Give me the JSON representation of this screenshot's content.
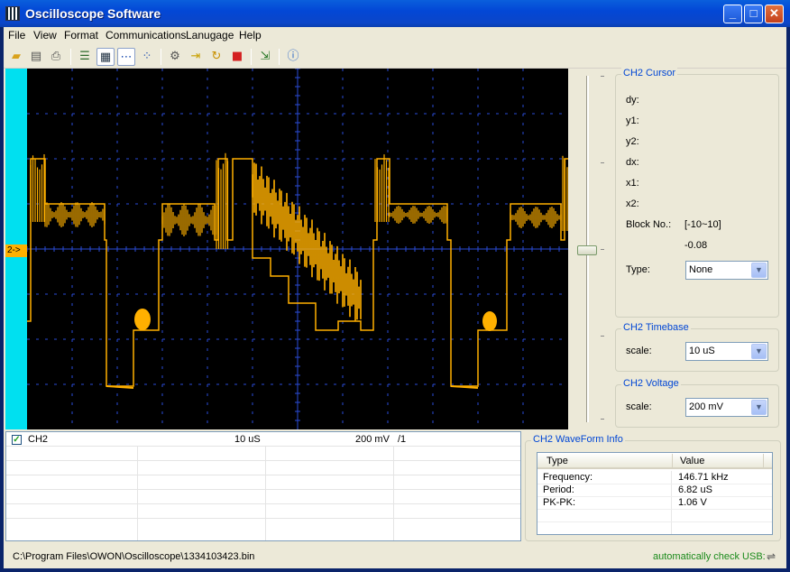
{
  "window": {
    "title": "Oscilloscope Software"
  },
  "title_buttons": [
    "_",
    "□",
    "✕"
  ],
  "menu": [
    "File",
    "View",
    "Format",
    "Communications",
    "Lanugage",
    "Help"
  ],
  "toolbar": {
    "icons": [
      "open-folder-icon",
      "print-icon",
      "print-preview-icon",
      "list-icon",
      "grid-icon",
      "dots-line-icon",
      "dots-icon",
      "settings-icon",
      "import-icon",
      "refresh-icon",
      "stop-icon",
      "export-icon",
      "help-icon"
    ]
  },
  "scope": {
    "channel_marker": "2->",
    "background": "#000000",
    "trace_color": "#ffb000",
    "grid_color": "#2a4cd8"
  },
  "cursor_panel": {
    "title": "CH2 Cursor",
    "labels": {
      "dy": "dy:",
      "y1": "y1:",
      "y2": "y2:",
      "dx": "dx:",
      "x1": "x1:",
      "x2": "x2:",
      "block": "Block No.:",
      "type": "Type:"
    },
    "block_range": "[-10~10]",
    "block_value": "-0.08",
    "type_value": "None"
  },
  "timebase_panel": {
    "title": "CH2 Timebase",
    "label": "scale:",
    "value": "10 uS"
  },
  "voltage_panel": {
    "title": "CH2 Voltage",
    "label": "scale:",
    "value": "200 mV"
  },
  "channel_table": {
    "row": {
      "checked": "✓",
      "channel": "CH2",
      "time": "10 uS",
      "volt": "200 mV",
      "ratio": "/1"
    }
  },
  "waveform_info": {
    "title": "CH2 WaveForm Info",
    "columns": [
      "Type",
      "Value"
    ],
    "rows": [
      {
        "type": "Frequency:",
        "value": "146.71 kHz"
      },
      {
        "type": "Period:",
        "value": "6.82 uS"
      },
      {
        "type": "PK-PK:",
        "value": "1.06 V"
      }
    ]
  },
  "status": {
    "path": "C:\\Program Files\\OWON\\Oscilloscope\\1334103423.bin",
    "usb": "automatically check USB:"
  }
}
